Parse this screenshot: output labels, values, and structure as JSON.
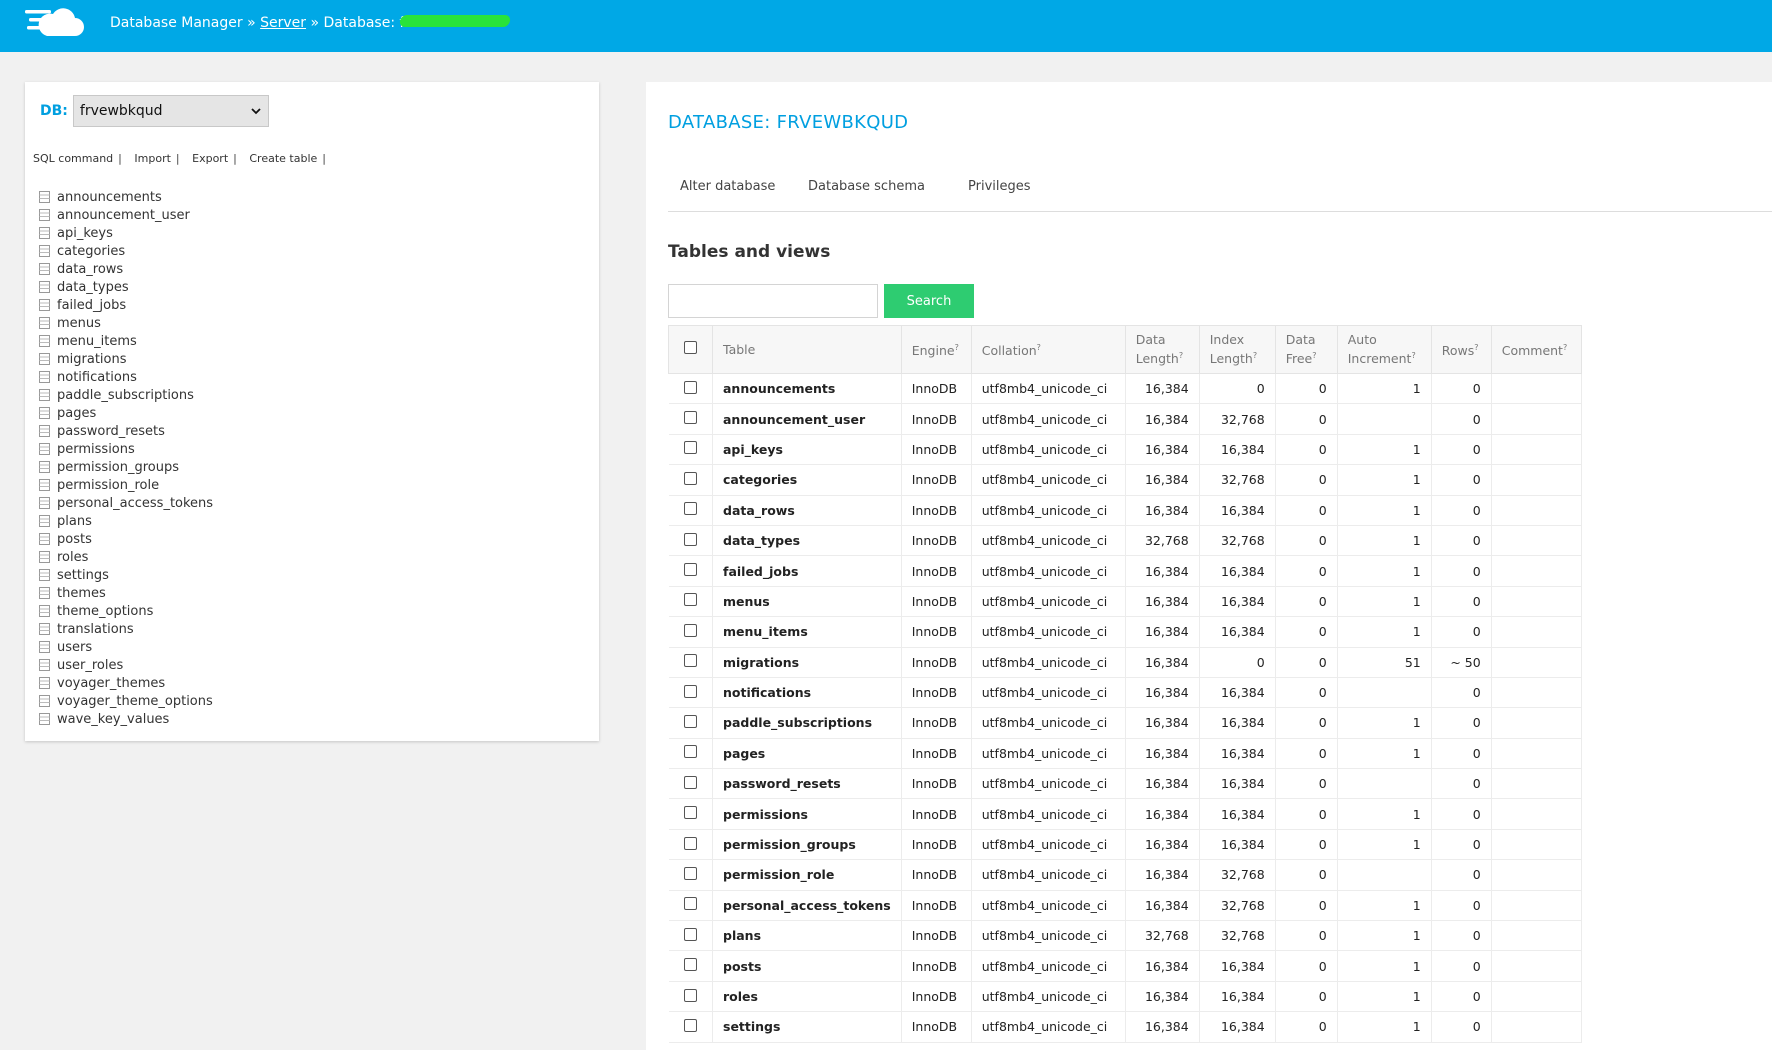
{
  "header": {
    "app_title": "Database Manager",
    "sep1": "»",
    "server_link": "Server",
    "sep2": "»",
    "database_prefix": "Database: fr"
  },
  "sidebar": {
    "db_label": "DB:",
    "db_selected": "frvewbkqud",
    "commands": [
      "SQL command",
      "Import",
      "Export",
      "Create table"
    ],
    "command_sep": "|",
    "tables": [
      "announcements",
      "announcement_user",
      "api_keys",
      "categories",
      "data_rows",
      "data_types",
      "failed_jobs",
      "menus",
      "menu_items",
      "migrations",
      "notifications",
      "paddle_subscriptions",
      "pages",
      "password_resets",
      "permissions",
      "permission_groups",
      "permission_role",
      "personal_access_tokens",
      "plans",
      "posts",
      "roles",
      "settings",
      "themes",
      "theme_options",
      "translations",
      "users",
      "user_roles",
      "voyager_themes",
      "voyager_theme_options",
      "wave_key_values"
    ]
  },
  "main": {
    "title": "DATABASE: FRVEWBKQUD",
    "tabs": [
      "Alter database",
      "Database schema",
      "Privileges"
    ],
    "section_title": "Tables and views",
    "search_value": "",
    "search_button": "Search",
    "columns": {
      "table": "Table",
      "engine": "Engine",
      "collation": "Collation",
      "data_length_1": "Data",
      "data_length_2": "Length",
      "index_length_1": "Index",
      "index_length_2": "Length",
      "data_free_1": "Data",
      "data_free_2": "Free",
      "auto_inc_1": "Auto",
      "auto_inc_2": "Increment",
      "rows": "Rows",
      "comment": "Comment",
      "help_mark": "?"
    },
    "rows": [
      [
        "announcements",
        "InnoDB",
        "utf8mb4_unicode_ci",
        "16,384",
        "0",
        "0",
        "1",
        "0"
      ],
      [
        "announcement_user",
        "InnoDB",
        "utf8mb4_unicode_ci",
        "16,384",
        "32,768",
        "0",
        "",
        "0"
      ],
      [
        "api_keys",
        "InnoDB",
        "utf8mb4_unicode_ci",
        "16,384",
        "16,384",
        "0",
        "1",
        "0"
      ],
      [
        "categories",
        "InnoDB",
        "utf8mb4_unicode_ci",
        "16,384",
        "32,768",
        "0",
        "1",
        "0"
      ],
      [
        "data_rows",
        "InnoDB",
        "utf8mb4_unicode_ci",
        "16,384",
        "16,384",
        "0",
        "1",
        "0"
      ],
      [
        "data_types",
        "InnoDB",
        "utf8mb4_unicode_ci",
        "32,768",
        "32,768",
        "0",
        "1",
        "0"
      ],
      [
        "failed_jobs",
        "InnoDB",
        "utf8mb4_unicode_ci",
        "16,384",
        "16,384",
        "0",
        "1",
        "0"
      ],
      [
        "menus",
        "InnoDB",
        "utf8mb4_unicode_ci",
        "16,384",
        "16,384",
        "0",
        "1",
        "0"
      ],
      [
        "menu_items",
        "InnoDB",
        "utf8mb4_unicode_ci",
        "16,384",
        "16,384",
        "0",
        "1",
        "0"
      ],
      [
        "migrations",
        "InnoDB",
        "utf8mb4_unicode_ci",
        "16,384",
        "0",
        "0",
        "51",
        "~ 50"
      ],
      [
        "notifications",
        "InnoDB",
        "utf8mb4_unicode_ci",
        "16,384",
        "16,384",
        "0",
        "",
        "0"
      ],
      [
        "paddle_subscriptions",
        "InnoDB",
        "utf8mb4_unicode_ci",
        "16,384",
        "16,384",
        "0",
        "1",
        "0"
      ],
      [
        "pages",
        "InnoDB",
        "utf8mb4_unicode_ci",
        "16,384",
        "16,384",
        "0",
        "1",
        "0"
      ],
      [
        "password_resets",
        "InnoDB",
        "utf8mb4_unicode_ci",
        "16,384",
        "16,384",
        "0",
        "",
        "0"
      ],
      [
        "permissions",
        "InnoDB",
        "utf8mb4_unicode_ci",
        "16,384",
        "16,384",
        "0",
        "1",
        "0"
      ],
      [
        "permission_groups",
        "InnoDB",
        "utf8mb4_unicode_ci",
        "16,384",
        "16,384",
        "0",
        "1",
        "0"
      ],
      [
        "permission_role",
        "InnoDB",
        "utf8mb4_unicode_ci",
        "16,384",
        "32,768",
        "0",
        "",
        "0"
      ],
      [
        "personal_access_tokens",
        "InnoDB",
        "utf8mb4_unicode_ci",
        "16,384",
        "32,768",
        "0",
        "1",
        "0"
      ],
      [
        "plans",
        "InnoDB",
        "utf8mb4_unicode_ci",
        "32,768",
        "32,768",
        "0",
        "1",
        "0"
      ],
      [
        "posts",
        "InnoDB",
        "utf8mb4_unicode_ci",
        "16,384",
        "16,384",
        "0",
        "1",
        "0"
      ],
      [
        "roles",
        "InnoDB",
        "utf8mb4_unicode_ci",
        "16,384",
        "16,384",
        "0",
        "1",
        "0"
      ],
      [
        "settings",
        "InnoDB",
        "utf8mb4_unicode_ci",
        "16,384",
        "16,384",
        "0",
        "1",
        "0"
      ]
    ]
  },
  "colors": {
    "header_bg": "#00a8e6",
    "accent": "#009fe0",
    "search_button": "#2ecc71",
    "redaction": "#29e33b"
  },
  "icons": {
    "logo": "cloud-logo-icon",
    "table_item": "table-icon",
    "select": "chevron-down-icon"
  }
}
